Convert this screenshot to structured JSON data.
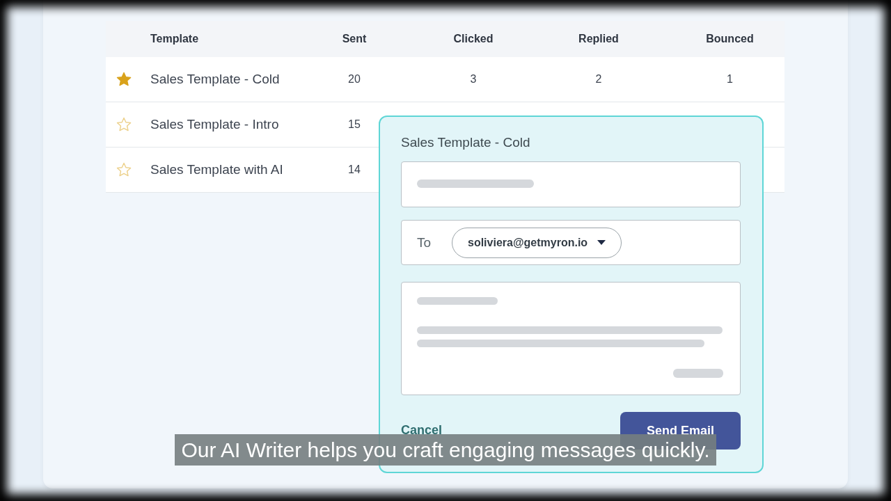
{
  "table": {
    "columns": [
      "Template",
      "Sent",
      "Clicked",
      "Replied",
      "Bounced"
    ],
    "rows": [
      {
        "starred": true,
        "cells": [
          "Sales Template - Cold",
          "20",
          "3",
          "2",
          "1"
        ]
      },
      {
        "starred": false,
        "cells": [
          "Sales Template - Intro",
          "15"
        ]
      },
      {
        "starred": false,
        "cells": [
          "Sales Template with AI",
          "14"
        ]
      }
    ]
  },
  "dialog": {
    "title": "Sales Template - Cold",
    "to_label": "To",
    "recipient": "soliviera@getmyron.io",
    "cancel": "Cancel",
    "send": "Send Email"
  },
  "caption": "Our AI Writer helps you craft engaging messages quickly."
}
